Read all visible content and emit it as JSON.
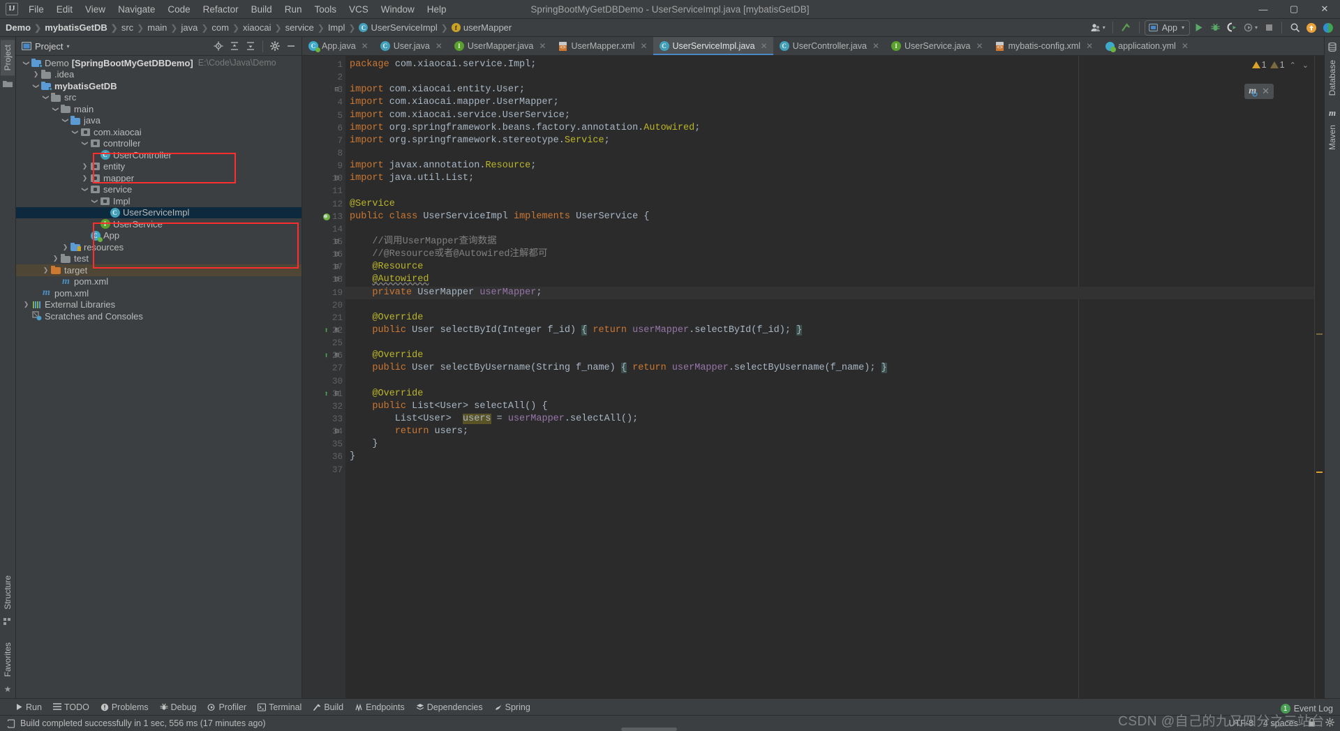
{
  "window": {
    "title": "SpringBootMyGetDBDemo - UserServiceImpl.java [mybatisGetDB]",
    "logo": "IJ",
    "minimize": "—",
    "maximize": "▢",
    "close": "✕"
  },
  "menubar": [
    {
      "label": "File"
    },
    {
      "label": "Edit"
    },
    {
      "label": "View"
    },
    {
      "label": "Navigate"
    },
    {
      "label": "Code"
    },
    {
      "label": "Refactor"
    },
    {
      "label": "Build"
    },
    {
      "label": "Run"
    },
    {
      "label": "Tools"
    },
    {
      "label": "VCS"
    },
    {
      "label": "Window"
    },
    {
      "label": "Help"
    }
  ],
  "breadcrumb": [
    {
      "label": "Demo",
      "bold": true,
      "icon": ""
    },
    {
      "label": "mybatisGetDB",
      "bold": true,
      "icon": ""
    },
    {
      "label": "src",
      "bold": false,
      "icon": ""
    },
    {
      "label": "main",
      "bold": false,
      "icon": ""
    },
    {
      "label": "java",
      "bold": false,
      "icon": ""
    },
    {
      "label": "com",
      "bold": false,
      "icon": ""
    },
    {
      "label": "xiaocai",
      "bold": false,
      "icon": ""
    },
    {
      "label": "service",
      "bold": false,
      "icon": ""
    },
    {
      "label": "Impl",
      "bold": false,
      "icon": ""
    },
    {
      "label": "UserServiceImpl",
      "bold": false,
      "icon": "class-icon"
    },
    {
      "label": "userMapper",
      "bold": false,
      "icon": "field-icon"
    }
  ],
  "toolbar": {
    "account_icon": "account-icon",
    "update_icon": "vcs-update-icon",
    "run_config": "App",
    "run_icon": "run-icon",
    "debug_icon": "debug-icon",
    "run_coverage_icon": "run-with-coverage-icon",
    "profile_icon": "profiler-icon",
    "stop_icon": "stop-icon",
    "search_icon": "search-everywhere-icon",
    "notify_icon": "update-available-icon",
    "help_icon": "ide-help-icon"
  },
  "project_panel": {
    "title": "Project",
    "actions": [
      "locate-icon",
      "expand-all-icon",
      "collapse-all-icon",
      "settings-icon",
      "hide-icon"
    ],
    "tree": [
      {
        "depth": 0,
        "label": "Demo",
        "suffix": "[SpringBootMyGetDBDemo]",
        "path": "E:\\Code\\Java\\Demo",
        "icon": "module-folder-icon",
        "twist": "open",
        "bold_suffix": true
      },
      {
        "depth": 1,
        "label": ".idea",
        "icon": "folder-icon",
        "twist": "closed"
      },
      {
        "depth": 1,
        "label": "mybatisGetDB",
        "icon": "module-folder-icon",
        "twist": "open",
        "bold": true
      },
      {
        "depth": 2,
        "label": "src",
        "icon": "folder-icon",
        "twist": "open"
      },
      {
        "depth": 3,
        "label": "main",
        "icon": "folder-icon",
        "twist": "open"
      },
      {
        "depth": 4,
        "label": "java",
        "icon": "source-folder-icon",
        "twist": "open"
      },
      {
        "depth": 5,
        "label": "com.xiaocai",
        "icon": "package-icon",
        "twist": "open"
      },
      {
        "depth": 6,
        "label": "controller",
        "icon": "package-icon",
        "twist": "open"
      },
      {
        "depth": 7,
        "label": "UserController",
        "icon": "class-icon",
        "twist": "none"
      },
      {
        "depth": 6,
        "label": "entity",
        "icon": "package-icon",
        "twist": "closed"
      },
      {
        "depth": 6,
        "label": "mapper",
        "icon": "package-icon",
        "twist": "closed"
      },
      {
        "depth": 6,
        "label": "service",
        "icon": "package-icon",
        "twist": "open"
      },
      {
        "depth": 7,
        "label": "Impl",
        "icon": "package-icon",
        "twist": "open"
      },
      {
        "depth": 8,
        "label": "UserServiceImpl",
        "icon": "class-icon",
        "twist": "none",
        "selected": true
      },
      {
        "depth": 7,
        "label": "UserService",
        "icon": "interface-icon",
        "twist": "none"
      },
      {
        "depth": 6,
        "label": "App",
        "icon": "spring-app-icon",
        "twist": "none"
      },
      {
        "depth": 4,
        "label": "resources",
        "icon": "resources-folder-icon",
        "twist": "closed"
      },
      {
        "depth": 3,
        "label": "test",
        "icon": "folder-icon",
        "twist": "closed"
      },
      {
        "depth": 2,
        "label": "target",
        "icon": "target-folder-icon",
        "twist": "closed",
        "highlight": true
      },
      {
        "depth": 3,
        "label": "pom.xml",
        "icon": "maven-icon",
        "twist": "none"
      },
      {
        "depth": 1,
        "label": "pom.xml",
        "icon": "maven-icon",
        "twist": "none"
      },
      {
        "depth": 0,
        "label": "External Libraries",
        "icon": "libraries-icon",
        "twist": "closed"
      },
      {
        "depth": 0,
        "label": "Scratches and Consoles",
        "icon": "scratches-icon",
        "twist": "none"
      }
    ]
  },
  "left_stripe": {
    "top": [
      {
        "label": "Project",
        "active": true
      }
    ],
    "bottom": [
      {
        "label": "Structure"
      },
      {
        "label": "Favorites"
      }
    ]
  },
  "right_stripe": {
    "top": [
      {
        "label": "Database"
      },
      {
        "label": "Maven"
      }
    ]
  },
  "editor_tabs": [
    {
      "label": "App.java",
      "icon": "spring-class-icon",
      "active": false
    },
    {
      "label": "User.java",
      "icon": "class-icon",
      "active": false
    },
    {
      "label": "UserMapper.java",
      "icon": "interface-icon",
      "active": false
    },
    {
      "label": "UserMapper.xml",
      "icon": "xml-icon",
      "active": false
    },
    {
      "label": "UserServiceImpl.java",
      "icon": "class-icon",
      "active": true
    },
    {
      "label": "UserController.java",
      "icon": "class-icon",
      "active": false
    },
    {
      "label": "UserService.java",
      "icon": "interface-icon",
      "active": false
    },
    {
      "label": "mybatis-config.xml",
      "icon": "xml-icon",
      "active": false
    },
    {
      "label": "application.yml",
      "icon": "yml-icon",
      "active": false
    }
  ],
  "inspection_widget": {
    "warnings": "1",
    "weak_warnings": "1",
    "up_chevron": "⌃",
    "down_chevron": "⌄"
  },
  "maven_float": {
    "icon": "maven-reload-icon",
    "close": "✕"
  },
  "code": {
    "file": "UserServiceImpl.java",
    "line_numbers": [
      1,
      2,
      3,
      4,
      5,
      6,
      7,
      8,
      9,
      10,
      11,
      12,
      13,
      14,
      15,
      16,
      17,
      18,
      19,
      20,
      21,
      22,
      25,
      26,
      27,
      30,
      31,
      32,
      33,
      34,
      35,
      36,
      37
    ],
    "lines": [
      "package com.xiaocai.service.Impl;",
      "",
      "import com.xiaocai.entity.User;",
      "import com.xiaocai.mapper.UserMapper;",
      "import com.xiaocai.service.UserService;",
      "import org.springframework.beans.factory.annotation.Autowired;",
      "import org.springframework.stereotype.Service;",
      "",
      "import javax.annotation.Resource;",
      "import java.util.List;",
      "",
      "@Service",
      "public class UserServiceImpl implements UserService {",
      "",
      "    //调用UserMapper查询数据",
      "    //@Resource或者@Autowired注解都可",
      "    @Resource",
      "    @Autowired",
      "    private UserMapper userMapper;",
      "",
      "    @Override",
      "    public User selectById(Integer f_id) { return userMapper.selectById(f_id); }",
      "",
      "    @Override",
      "    public User selectByUsername(String f_name) { return userMapper.selectByUsername(f_name); }",
      "",
      "    @Override",
      "    public List<User> selectAll() {",
      "        List<User>  users = userMapper.selectAll();",
      "        return users;",
      "    }",
      "}",
      ""
    ]
  },
  "bottom_tools": [
    {
      "label": "Run",
      "icon": "run-icon"
    },
    {
      "label": "TODO",
      "icon": "todo-icon"
    },
    {
      "label": "Problems",
      "icon": "problems-icon"
    },
    {
      "label": "Debug",
      "icon": "debug-icon"
    },
    {
      "label": "Profiler",
      "icon": "profiler-icon"
    },
    {
      "label": "Terminal",
      "icon": "terminal-icon"
    },
    {
      "label": "Build",
      "icon": "build-icon"
    },
    {
      "label": "Endpoints",
      "icon": "endpoints-icon"
    },
    {
      "label": "Dependencies",
      "icon": "dependencies-icon"
    },
    {
      "label": "Spring",
      "icon": "spring-icon"
    }
  ],
  "status_bar": {
    "message": "Build completed successfully in 1 sec, 556 ms (17 minutes ago)",
    "message_icon": "build-status-icon",
    "encoding": "UTF-8",
    "indent": "4 spaces",
    "lock_icon": "lock-icon",
    "settings_icon": "settings-icon"
  },
  "event_log": {
    "label": "Event Log",
    "count": "1"
  },
  "watermark": "CSDN @自己的九又四分之三站台",
  "colors": {
    "accent_blue": "#4a88c7",
    "selection": "#0d293e",
    "annotation_red": "#ff2e2e",
    "keyword_orange": "#cc7832",
    "annotation_yellow": "#bbb529",
    "field_purple": "#9876aa",
    "comment_gray": "#808080",
    "editor_bg": "#2b2b2b",
    "panel_bg": "#3c3f41"
  }
}
